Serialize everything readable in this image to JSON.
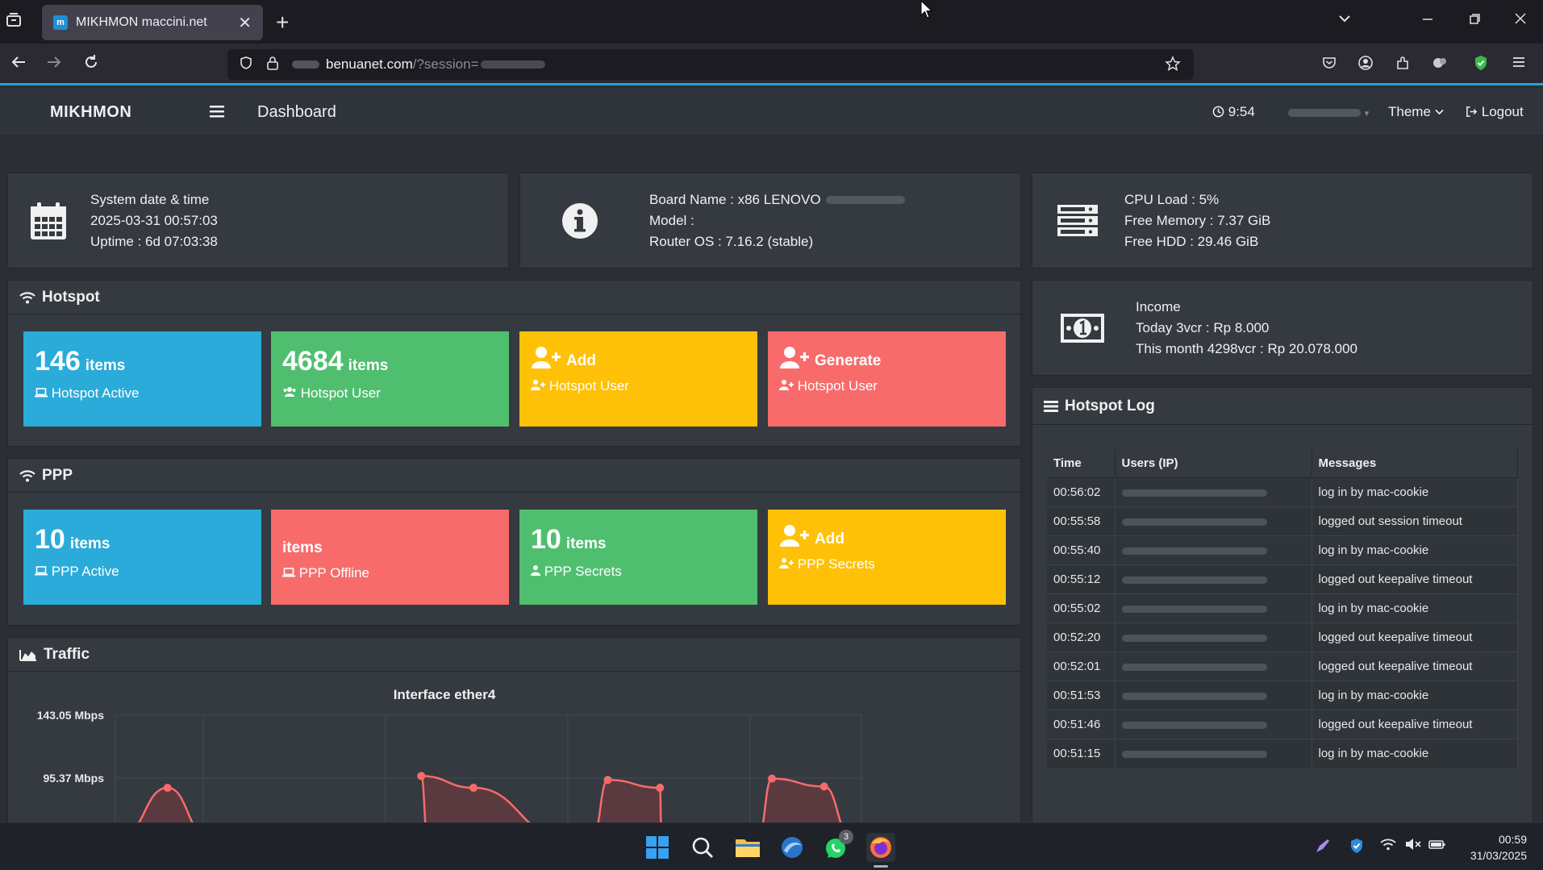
{
  "browser": {
    "tab_title": "MIKHMON maccini.net",
    "tab_close": "✕",
    "new_tab": "+",
    "url_domain": "benuanet.com",
    "url_path": "/?session="
  },
  "header": {
    "brand": "MIKHMON",
    "page_title": "Dashboard",
    "time": "9:54",
    "theme_label": "Theme",
    "logout_label": "Logout"
  },
  "system": {
    "line1": "System date & time",
    "line2": "2025-03-31 00:57:03",
    "line3": "Uptime : 6d 07:03:38"
  },
  "board": {
    "line1": "Board Name : x86 LENOVO",
    "line2": "Model :",
    "line3": "Router OS : 7.16.2 (stable)"
  },
  "resource": {
    "line1": "CPU Load : 5%",
    "line2": "Free Memory : 7.37 GiB",
    "line3": "Free HDD : 29.46 GiB"
  },
  "income": {
    "line1": "Income",
    "line2": "Today 3vcr : Rp 8.000",
    "line3": "This month 4298vcr : Rp 20.078.000"
  },
  "hotspot": {
    "title": "Hotspot",
    "active_count": "146",
    "active_unit": "items",
    "active_label": "Hotspot Active",
    "user_count": "4684",
    "user_unit": "items",
    "user_label": "Hotspot User",
    "add_title": "Add",
    "add_label": "Hotspot User",
    "generate_title": "Generate",
    "generate_label": "Hotspot User"
  },
  "ppp": {
    "title": "PPP",
    "active_count": "10",
    "active_unit": "items",
    "active_label": "PPP Active",
    "offline_unit": "items",
    "offline_label": "PPP Offline",
    "secrets_count": "10",
    "secrets_unit": "items",
    "secrets_label": "PPP Secrets",
    "add_title": "Add",
    "add_label": "PPP Secrets"
  },
  "traffic": {
    "title": "Traffic",
    "chart_title": "Interface ether4"
  },
  "chart_data": {
    "type": "area",
    "title": "Interface ether4",
    "y_ticks": [
      "143.05 Mbps",
      "95.37 Mbps"
    ],
    "ylim_visible": [
      95.37,
      143.05
    ],
    "series": [
      {
        "points": [
          {
            "x": 0.07,
            "y": 88
          },
          {
            "x": 0.41,
            "y": 97
          },
          {
            "x": 0.48,
            "y": 88
          },
          {
            "x": 0.66,
            "y": 94
          },
          {
            "x": 0.73,
            "y": 88
          },
          {
            "x": 0.88,
            "y": 95
          },
          {
            "x": 0.95,
            "y": 89
          }
        ]
      }
    ],
    "colors": {
      "line": "#f76b6b",
      "fill": "#5a3a3f"
    },
    "grid": true
  },
  "log": {
    "title": "Hotspot Log",
    "columns": [
      "Time",
      "Users (IP)",
      "Messages"
    ],
    "rows": [
      {
        "time": "00:56:02",
        "msg": "log in by mac-cookie"
      },
      {
        "time": "00:55:58",
        "msg": "logged out session timeout"
      },
      {
        "time": "00:55:40",
        "msg": "log in by mac-cookie"
      },
      {
        "time": "00:55:12",
        "msg": "logged out keepalive timeout"
      },
      {
        "time": "00:55:02",
        "msg": "log in by mac-cookie"
      },
      {
        "time": "00:52:20",
        "msg": "logged out keepalive timeout"
      },
      {
        "time": "00:52:01",
        "msg": "logged out keepalive timeout"
      },
      {
        "time": "00:51:53",
        "msg": "log in by mac-cookie"
      },
      {
        "time": "00:51:46",
        "msg": "logged out keepalive timeout"
      },
      {
        "time": "00:51:15",
        "msg": "log in by mac-cookie"
      }
    ]
  },
  "taskbar": {
    "whatsapp_badge": "3",
    "clock_time": "00:59",
    "clock_date": "31/03/2025"
  },
  "icons": {
    "calendar": "calendar-icon",
    "info": "info-icon",
    "server": "server-icon",
    "money": "money-icon",
    "wifi": "wifi-icon",
    "laptop": "laptop-icon",
    "users": "users-icon",
    "user-plus": "user-plus-icon",
    "area-chart": "area-chart-icon",
    "list": "list-icon"
  }
}
